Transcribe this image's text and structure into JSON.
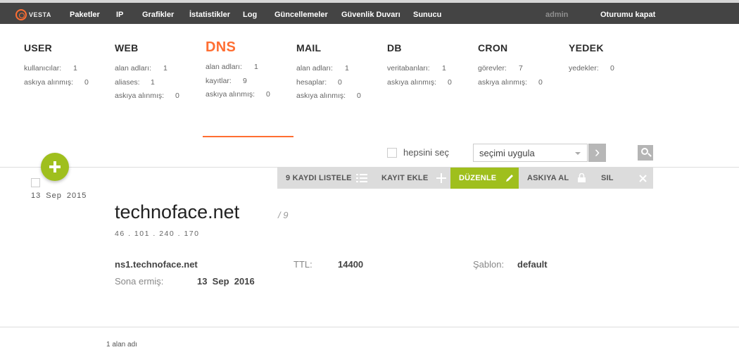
{
  "topbar": {
    "logo_text": "VESTA",
    "nav": [
      "Paketler",
      "IP",
      "Grafikler",
      "İstatistikler",
      "Log",
      "Güncellemeler",
      "Güvenlik Duvarı",
      "Sunucu"
    ],
    "user": "admin",
    "logout": "Oturumu kapat"
  },
  "tabs": [
    {
      "title": "USER",
      "stats": [
        [
          "kullanıcılar:",
          "1"
        ],
        [
          "askıya alınmış:",
          "0"
        ]
      ]
    },
    {
      "title": "WEB",
      "stats": [
        [
          "alan adları:",
          "1"
        ],
        [
          "aliases:",
          "1"
        ],
        [
          "askıya alınmış:",
          "0"
        ]
      ]
    },
    {
      "title": "DNS",
      "stats": [
        [
          "alan adları:",
          "1"
        ],
        [
          "kayıtlar:",
          "9"
        ],
        [
          "askıya alınmış:",
          "0"
        ]
      ]
    },
    {
      "title": "MAIL",
      "stats": [
        [
          "alan adları:",
          "1"
        ],
        [
          "hesaplar:",
          "0"
        ],
        [
          "askıya alınmış:",
          "0"
        ]
      ]
    },
    {
      "title": "DB",
      "stats": [
        [
          "veritabanları:",
          "1"
        ],
        [
          "askıya alınmış:",
          "0"
        ]
      ]
    },
    {
      "title": "CRON",
      "stats": [
        [
          "görevler:",
          "7"
        ],
        [
          "askıya alınmış:",
          "0"
        ]
      ]
    },
    {
      "title": "YEDEK",
      "stats": [
        [
          "yedekler:",
          "0"
        ]
      ]
    }
  ],
  "active_tab": "DNS",
  "toolbar": {
    "select_all": "hepsini seç",
    "apply_select": "seçimi uygula",
    "apply_go": "›"
  },
  "actions": {
    "list": "9 KAYDI LISTELE",
    "add": "KAYIT EKLE",
    "edit": "DÜZENLE",
    "suspend": "ASKIYA AL",
    "delete": "SIL"
  },
  "record": {
    "date": "13  Sep  2015",
    "domain": "technoface.net",
    "count": "/ 9",
    "ip": "46 . 101 . 240 . 170",
    "ns": "ns1.technoface.net",
    "ttl_label": "TTL:",
    "ttl_value": "14400",
    "template_label": "Şablon:",
    "template_value": "default",
    "expire_label": "Sona ermiş:",
    "expire_value": "13  Sep  2016"
  },
  "footer": {
    "count": "1 alan adı"
  },
  "colors": {
    "accent": "#ff6e32",
    "green": "#9fbf1d",
    "topbar": "#444444"
  }
}
